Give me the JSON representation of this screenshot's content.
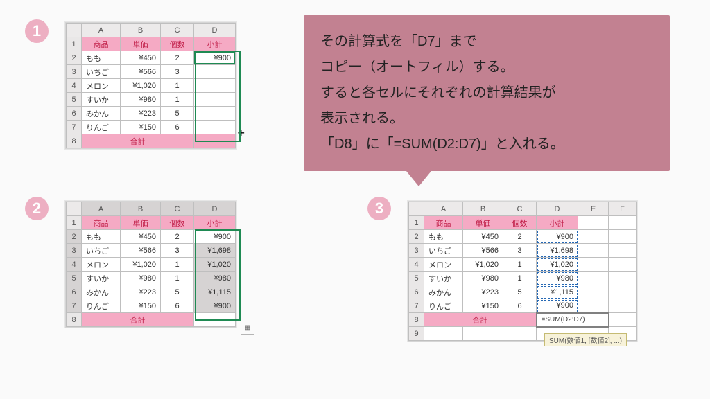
{
  "badges": {
    "b1": "1",
    "b2": "2",
    "b3": "3"
  },
  "bubble": {
    "l1": "その計算式を「D7」まで",
    "l2": "コピー（オートフィル）する。",
    "l3": "すると各セルにそれぞれの計算結果が",
    "l4": "表示される。",
    "l5": "「D8」に「=SUM(D2:D7)」と入れる。"
  },
  "headers": {
    "A": "A",
    "B": "B",
    "C": "C",
    "D": "D",
    "E": "E",
    "F": "F"
  },
  "col_labels": {
    "name": "商品",
    "price": "単価",
    "qty": "個数",
    "sub": "小計",
    "total": "合計"
  },
  "products": [
    {
      "name": "もも",
      "price": "¥450",
      "qty": "2",
      "sub1": "¥900",
      "sub2": "¥900",
      "sub3": "¥900"
    },
    {
      "name": "いちご",
      "price": "¥566",
      "qty": "3",
      "sub1": "",
      "sub2": "¥1,698",
      "sub3": "¥1,698"
    },
    {
      "name": "メロン",
      "price": "¥1,020",
      "qty": "1",
      "sub1": "",
      "sub2": "¥1,020",
      "sub3": "¥1,020"
    },
    {
      "name": "すいか",
      "price": "¥980",
      "qty": "1",
      "sub1": "",
      "sub2": "¥980",
      "sub3": "¥980"
    },
    {
      "name": "みかん",
      "price": "¥223",
      "qty": "5",
      "sub1": "",
      "sub2": "¥1,115",
      "sub3": "¥1,115"
    },
    {
      "name": "りんご",
      "price": "¥150",
      "qty": "6",
      "sub1": "",
      "sub2": "¥900",
      "sub3": "¥900"
    }
  ],
  "sheet3": {
    "formula": "=SUM(D2:D7)",
    "tooltip": "SUM(数値1, [数値2], ...)"
  }
}
